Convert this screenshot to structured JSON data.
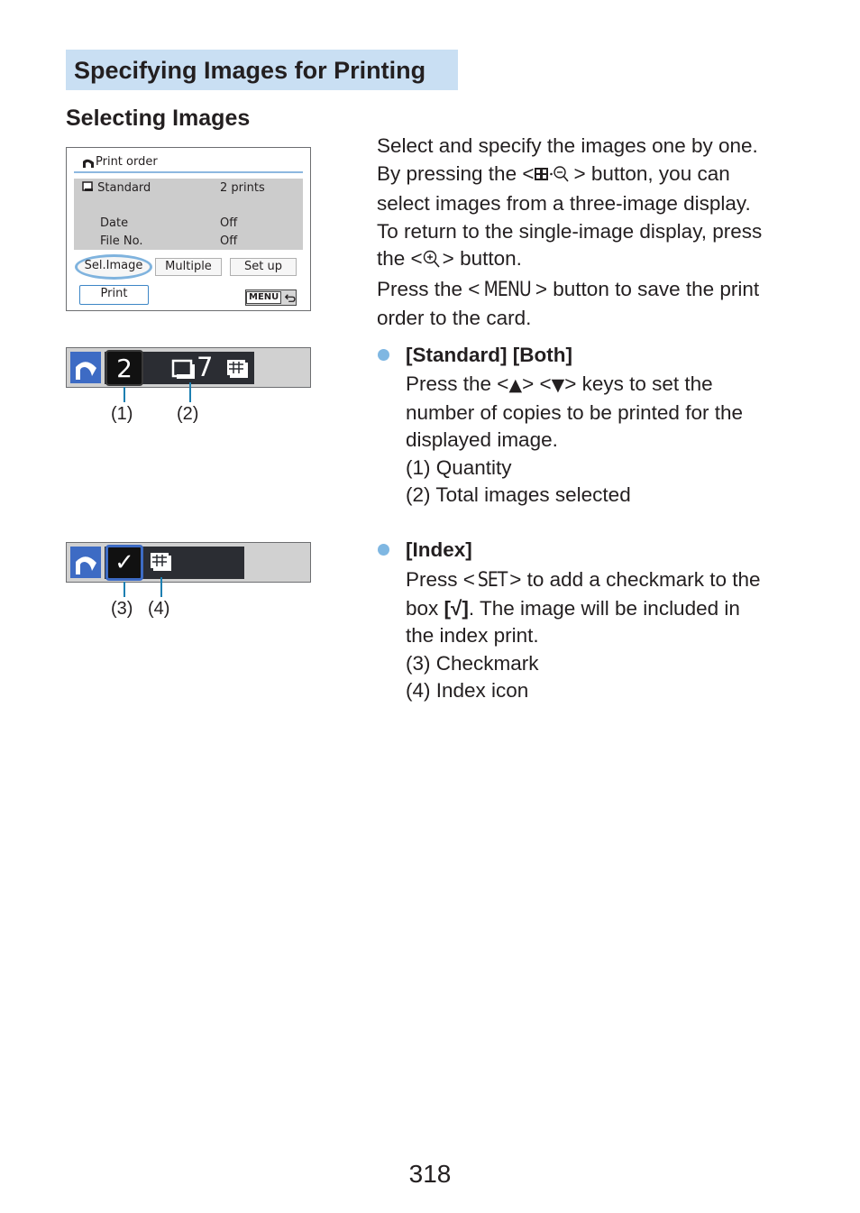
{
  "page": {
    "section_title": "Specifying Images for Printing",
    "subsection_title": "Selecting Images",
    "page_number": "318"
  },
  "camera_screen": {
    "title": "Print order",
    "rows": [
      {
        "label": "Standard",
        "value": "2 prints"
      },
      {
        "label": "Date",
        "value": "Off"
      },
      {
        "label": "File No.",
        "value": "Off"
      }
    ],
    "buttons": {
      "sel_image": "Sel.Image",
      "multiple": "Multiple",
      "set_up": "Set up",
      "print": "Print",
      "menu": "MENU"
    },
    "highlighted_button": "Sel.Image"
  },
  "strip_standard": {
    "quantity": "2",
    "total_selected": "7",
    "callouts": [
      "(1)",
      "(2)"
    ]
  },
  "strip_index": {
    "checkmark": "✓",
    "callouts": [
      "(3)",
      "(4)"
    ]
  },
  "intro": {
    "line1": "Select and specify the images one by one.",
    "line2_pre": "By pressing the <",
    "line2_post": "> button, you can",
    "line3": "select images from a three-image display.",
    "line4": "To return to the single-image display, press",
    "line5_pre": "the <",
    "line5_post": "> button.",
    "line6_pre": "Press the <",
    "line6_key": "MENU",
    "line6_post": "> button to save the print",
    "line7": "order to the card."
  },
  "bullets": [
    {
      "heading": "[Standard] [Both]",
      "lines": [
        "number of copies to be printed for the",
        "displayed image.",
        "(1) Quantity",
        "(2) Total images selected"
      ],
      "first_line_pre": "Press the <",
      "first_line_up": "▲",
      "first_line_mid": "> <",
      "first_line_down": "▼",
      "first_line_post": "> keys to set the"
    },
    {
      "heading": "[Index]",
      "first_line_pre": "Press <",
      "first_line_key": "SET",
      "first_line_post": "> to add a checkmark to the",
      "second_line_pre": "box ",
      "second_line_box": "[√]",
      "second_line_post": ". The image will be included in",
      "lines": [
        "the index print.",
        "(3) Checkmark",
        "(4) Index icon"
      ]
    }
  ],
  "colors": {
    "heading_bg": "#c9dff3",
    "bullet": "#7fb7e2",
    "print_icon_bg": "#3d6bc4",
    "leader_line": "#1d7fb1"
  }
}
